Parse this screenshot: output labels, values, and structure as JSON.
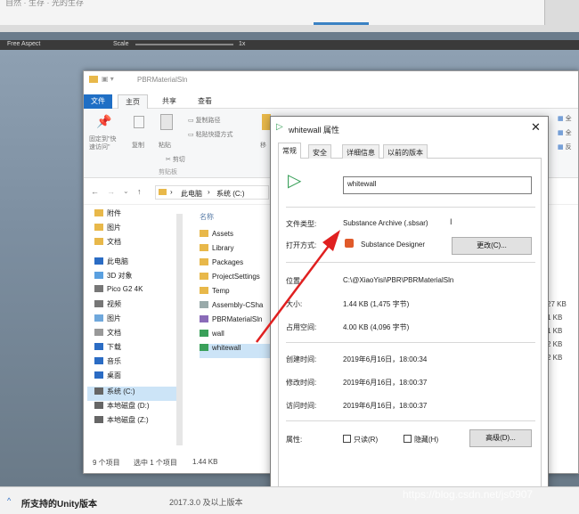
{
  "top": {
    "snippet": "自然 · 生存 · 光的生存"
  },
  "unity": {
    "aspect": "Free Aspect",
    "scale_label": "Scale",
    "scale_value": "1x"
  },
  "explorer": {
    "title": "PBRMaterialSln",
    "tabs": [
      "文件",
      "主页",
      "共享",
      "查看"
    ],
    "ribbon": {
      "pin_label": "固定到\"快\n速访问\"",
      "copy_label": "复制",
      "paste_label": "粘贴",
      "copy_path": "复制路径",
      "paste_shortcut": "粘贴快捷方式",
      "cut": "剪切",
      "group_clipboard": "剪贴板",
      "move_to": "移",
      "right_items": [
        "全",
        "全",
        "反"
      ]
    },
    "address": [
      "此电脑",
      "系统 (C:)"
    ],
    "nav_items": [
      "附件",
      "图片",
      "文档",
      "此电脑",
      "3D 对象",
      "Pico G2 4K",
      "视频",
      "图片",
      "文档",
      "下载",
      "音乐",
      "桌面",
      "系统 (C:)",
      "本地磁盘 (D:)",
      "本地磁盘 (Z:)"
    ],
    "column_name": "名称",
    "files": [
      "Assets",
      "Library",
      "Packages",
      "ProjectSettings",
      "Temp",
      "Assembly-CSha",
      "PBRMaterialSln",
      "wall",
      "whitewall"
    ],
    "sizes": [
      "27 KB",
      "1 KB",
      "1 KB",
      "2 KB",
      "2 KB"
    ],
    "status": {
      "count": "9 个项目",
      "selected": "选中 1 个项目",
      "size": "1.44 KB"
    }
  },
  "dialog": {
    "title": "whitewall 属性",
    "tabs": [
      "常规",
      "安全",
      "详细信息",
      "以前的版本"
    ],
    "filename": "whitewall",
    "rows": [
      {
        "label": "文件类型:",
        "value": "Substance Archive (.sbsar)"
      },
      {
        "label": "打开方式:",
        "value": "Substance Designer"
      },
      {
        "label": "位置:",
        "value": "C:\\@XiaoYisi\\PBR\\PBRMaterialSln"
      },
      {
        "label": "大小:",
        "value": "1.44 KB (1,475 字节)"
      },
      {
        "label": "占用空间:",
        "value": "4.00 KB (4,096 字节)"
      },
      {
        "label": "创建时间:",
        "value": "2019年6月16日，18:00:34"
      },
      {
        "label": "修改时间:",
        "value": "2019年6月16日，18:00:37"
      },
      {
        "label": "访问时间:",
        "value": "2019年6月16日，18:00:37"
      }
    ],
    "change_button": "更改(C)...",
    "attributes_label": "属性:",
    "readonly": "只读(R)",
    "hidden": "隐藏(H)",
    "advanced": "高级(D)..."
  },
  "bottom": {
    "left": "所支持的Unity版本",
    "right": "2017.3.0 及以上版本"
  },
  "watermark": "https://blog.csdn.net/js0907",
  "colors": {
    "folder": "#e8b84a",
    "accent": "#2b6cc4",
    "substance": "#3aa05a",
    "arrow": "#e02020"
  }
}
